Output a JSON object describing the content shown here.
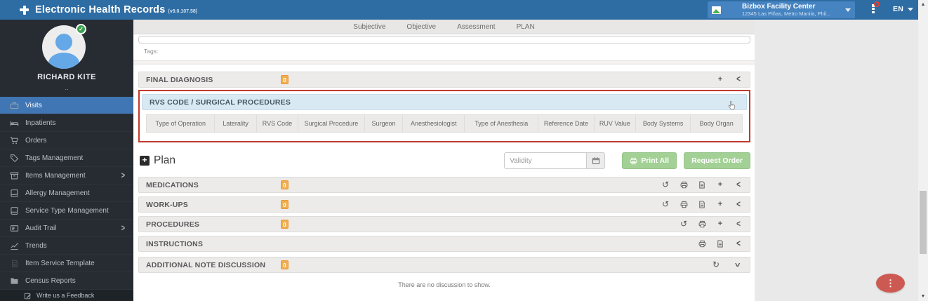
{
  "header": {
    "app_title": "Electronic Health Records",
    "app_version": "(v9.0.107.58)",
    "facility_name": "Bizbox Facility Center",
    "facility_address": "12345 Las Piñas, Metro Manila, Phil...",
    "language": "EN"
  },
  "sidebar": {
    "user_name": "RICHARD KITE",
    "user_subtitle": "..",
    "items": [
      {
        "label": "Visits",
        "icon": "briefcase",
        "active": true
      },
      {
        "label": "Inpatients",
        "icon": "bed"
      },
      {
        "label": "Orders",
        "icon": "cart"
      },
      {
        "label": "Tags Management",
        "icon": "tag"
      },
      {
        "label": "Items Management",
        "icon": "box",
        "has_submenu": true
      },
      {
        "label": "Allergy Management",
        "icon": "book"
      },
      {
        "label": "Service Type Management",
        "icon": "book"
      },
      {
        "label": "Audit Trail",
        "icon": "card",
        "has_submenu": true
      },
      {
        "label": "Trends",
        "icon": "chart"
      },
      {
        "label": "Item Service Template",
        "icon": "file"
      },
      {
        "label": "Census Reports",
        "icon": "folder"
      },
      {
        "label": "Write us a Feedback",
        "icon": "pencil"
      }
    ]
  },
  "note_tabs": [
    "Subjective",
    "Objective",
    "Assessment",
    "PLAN"
  ],
  "editor": {
    "tags_label": "Tags:"
  },
  "sections": {
    "final_diagnosis": {
      "title": "FINAL DIAGNOSIS",
      "badge": "0",
      "icons": [
        "plus",
        "chevron-left"
      ]
    },
    "rvs": {
      "title": "RVS CODE / SURGICAL PROCEDURES",
      "columns": [
        "Type of Operation",
        "Laterality",
        "RVS Code",
        "Surgical Procedure",
        "Surgeon",
        "Anesthesiologist",
        "Type of Anesthesia",
        "Reference Date",
        "RUV Value",
        "Body Systems",
        "Body Organ"
      ]
    },
    "plan": {
      "title": "Plan",
      "validity_placeholder": "Validity",
      "print_all_label": "Print All",
      "request_order_label": "Request Order"
    },
    "medications": {
      "title": "MEDICATIONS",
      "badge": "0",
      "icons": [
        "undo",
        "print",
        "file",
        "plus",
        "chevron-left"
      ]
    },
    "workups": {
      "title": "WORK-UPS",
      "badge": "0",
      "icons": [
        "undo",
        "print",
        "file",
        "plus",
        "chevron-left"
      ]
    },
    "procedures": {
      "title": "PROCEDURES",
      "badge": "0",
      "icons": [
        "undo",
        "print",
        "plus",
        "chevron-left"
      ]
    },
    "instructions": {
      "title": "INSTRUCTIONS",
      "icons": [
        "print",
        "file",
        "chevron-left"
      ]
    },
    "discussion": {
      "title": "ADDITIONAL NOTE DISCUSSION",
      "badge": "0",
      "icons": [
        "refresh",
        "chevron-down"
      ],
      "empty_message": "There are no discussion to show."
    }
  },
  "colors": {
    "header_blue": "#2e6da4",
    "active_item_blue": "#4076b4",
    "badge_orange": "#f0ad4e",
    "highlight_red": "#c2392e",
    "button_green": "#a2d095",
    "rvs_header_blue": "#d9e9f3",
    "fab_red": "#cd5a52"
  }
}
